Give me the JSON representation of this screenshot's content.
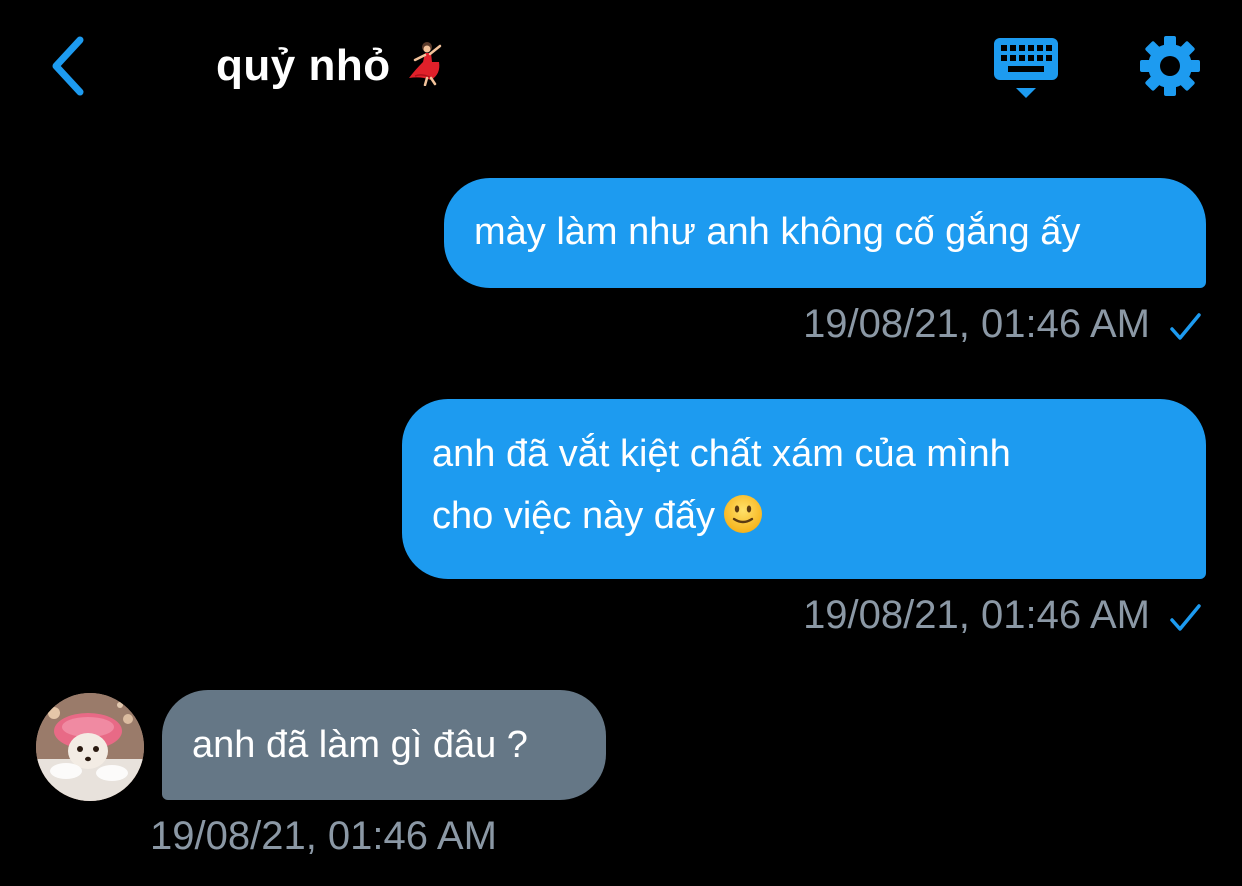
{
  "header": {
    "title": "quỷ nhỏ",
    "title_emoji": "woman-dancing-emoji",
    "back_icon": "chevron-left-icon",
    "keyboard_icon": "keyboard-icon",
    "settings_icon": "gear-icon"
  },
  "messages": [
    {
      "direction": "outgoing",
      "text": "mày làm như anh không cố gắng ấy",
      "timestamp": "19/08/21, 01:46 AM",
      "status_icon": "checkmark-icon"
    },
    {
      "direction": "outgoing",
      "line1": "anh đã vắt kiệt chất xám của mình",
      "line2": "cho việc này đấy",
      "emoji": "slightly-smiling-face-emoji",
      "timestamp": "19/08/21, 01:46 AM",
      "status_icon": "checkmark-icon"
    },
    {
      "direction": "incoming",
      "text": "anh đã làm gì đâu ?",
      "timestamp": "19/08/21, 01:46 AM",
      "avatar": "contact-avatar"
    }
  ],
  "colors": {
    "background": "#000000",
    "accent": "#1d9bf0",
    "outgoing_bubble": "#1d9bf0",
    "incoming_bubble": "#657786",
    "timestamp": "#8b98a5"
  }
}
